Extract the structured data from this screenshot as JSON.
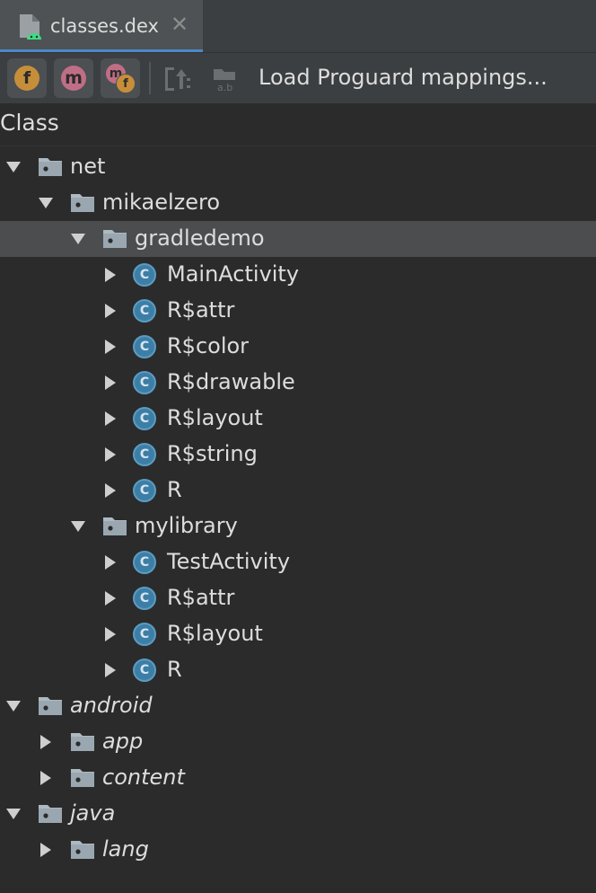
{
  "tab": {
    "label": "classes.dex",
    "close": "✕"
  },
  "toolbar": {
    "field_btn": "f",
    "method_btn": "m",
    "method_sub": "m",
    "method_sub_f": "f",
    "load_mappings": "Load Proguard mappings..."
  },
  "tree": {
    "header": "Class",
    "class_badge": "C",
    "rows": [
      {
        "label": "net",
        "kind": "package",
        "level": 0,
        "expanded": true,
        "italic": false
      },
      {
        "label": "mikaelzero",
        "kind": "package",
        "level": 1,
        "expanded": true,
        "italic": false
      },
      {
        "label": "gradledemo",
        "kind": "package",
        "level": 2,
        "expanded": true,
        "italic": false,
        "selected": true
      },
      {
        "label": "MainActivity",
        "kind": "class",
        "level": 3,
        "expanded": false
      },
      {
        "label": "R$attr",
        "kind": "class",
        "level": 3,
        "expanded": false
      },
      {
        "label": "R$color",
        "kind": "class",
        "level": 3,
        "expanded": false
      },
      {
        "label": "R$drawable",
        "kind": "class",
        "level": 3,
        "expanded": false
      },
      {
        "label": "R$layout",
        "kind": "class",
        "level": 3,
        "expanded": false
      },
      {
        "label": "R$string",
        "kind": "class",
        "level": 3,
        "expanded": false
      },
      {
        "label": "R",
        "kind": "class",
        "level": 3,
        "expanded": false
      },
      {
        "label": "mylibrary",
        "kind": "package",
        "level": 2,
        "expanded": true,
        "italic": false
      },
      {
        "label": "TestActivity",
        "kind": "class",
        "level": 3,
        "expanded": false
      },
      {
        "label": "R$attr",
        "kind": "class",
        "level": 3,
        "expanded": false
      },
      {
        "label": "R$layout",
        "kind": "class",
        "level": 3,
        "expanded": false
      },
      {
        "label": "R",
        "kind": "class",
        "level": 3,
        "expanded": false
      },
      {
        "label": "android",
        "kind": "package",
        "level": 0,
        "expanded": true,
        "italic": true
      },
      {
        "label": "app",
        "kind": "package",
        "level": 1,
        "expanded": false,
        "italic": true
      },
      {
        "label": "content",
        "kind": "package",
        "level": 1,
        "expanded": false,
        "italic": true
      },
      {
        "label": "java",
        "kind": "package",
        "level": 0,
        "expanded": true,
        "italic": true
      },
      {
        "label": "lang",
        "kind": "package",
        "level": 1,
        "expanded": false,
        "italic": true
      }
    ]
  },
  "colors": {
    "background": "#2b2b2b",
    "toolbar": "#3c3f41",
    "selection": "#4b4d4f",
    "accent": "#4a88c7",
    "class_icon": "#3d7ea6",
    "field_icon": "#c78e3a",
    "method_icon": "#c06e86"
  }
}
